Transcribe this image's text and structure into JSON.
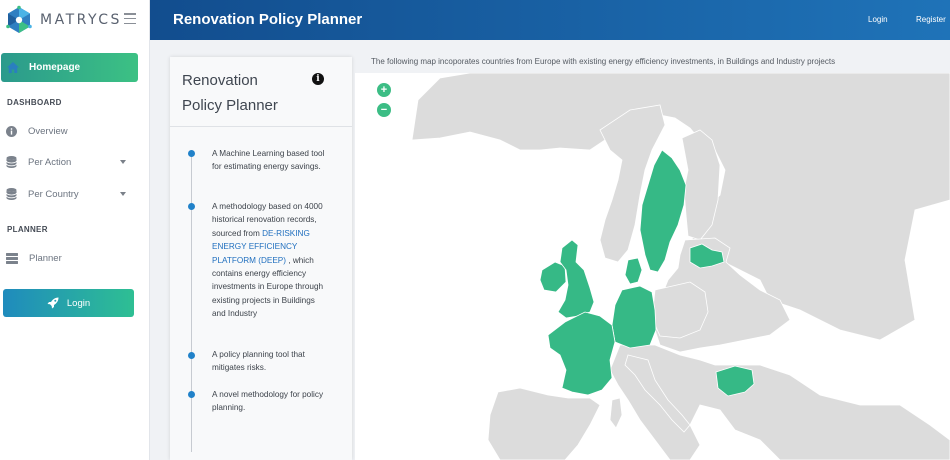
{
  "brand": {
    "name": "MATRYCS"
  },
  "sidebar": {
    "home_label": "Homepage",
    "dashboard_heading": "DASHBOARD",
    "overview_label": "Overview",
    "per_action_label": "Per Action",
    "per_country_label": "Per Country",
    "planner_heading": "PLANNER",
    "planner_label": "Planner",
    "login_label": "Login"
  },
  "header": {
    "title": "Renovation Policy Planner",
    "login": "Login",
    "register": "Register"
  },
  "card": {
    "title": "Renovation Policy Planner",
    "items": [
      {
        "text": "A Machine Learning based tool for estimating energy savings."
      },
      {
        "before": "A methodology based on 4000 historical renovation records, sourced from ",
        "link": "DE-RISKING ENERGY EFFICIENCY PLATFORM (DEEP)",
        "after": " , which contains energy efficiency investments in Europe through existing projects in Buildings and Industry"
      },
      {
        "text": "A policy planning tool that mitigates risks."
      },
      {
        "text": "A novel methodology for policy planning."
      }
    ]
  },
  "map": {
    "caption": "The following map incoporates countries from Europe with existing energy efficiency investments, in Buildings and Industry projects",
    "zoom_in": "+",
    "zoom_out": "−",
    "highlight_color": "#36b986",
    "base_color": "#dcdcdc",
    "highlighted_countries": [
      "United Kingdom",
      "Ireland",
      "France",
      "Germany",
      "Denmark",
      "Sweden",
      "Latvia",
      "Bulgaria"
    ]
  },
  "colors": {
    "header_start": "#124d8e",
    "header_end": "#1f73b8",
    "accent_green": "#3cc184",
    "accent_blue": "#2182c9"
  }
}
